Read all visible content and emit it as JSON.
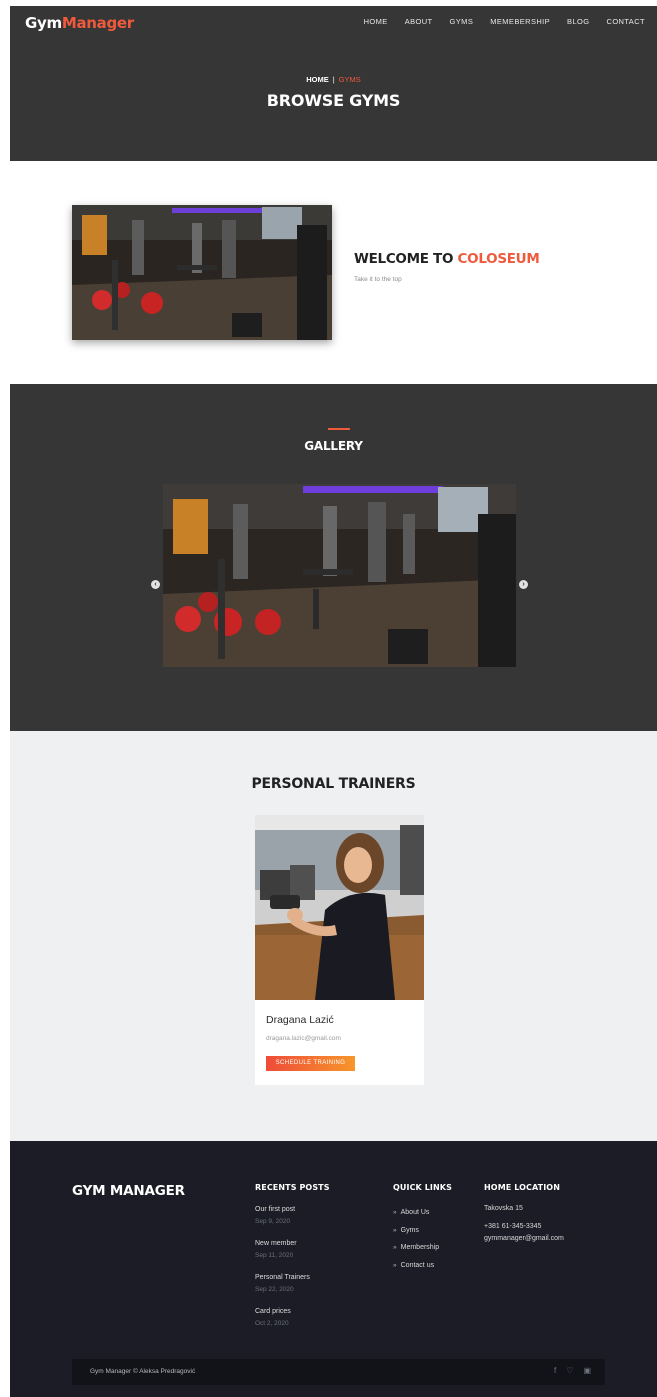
{
  "header": {
    "logo_part1": "Gym",
    "logo_part2": "Manager",
    "nav": [
      "HOME",
      "ABOUT",
      "GYMS",
      "MEMEBERSHIP",
      "BLOG",
      "CONTACT"
    ],
    "breadcrumb_home": "HOME",
    "breadcrumb_separator": "|",
    "breadcrumb_current": "GYMS",
    "title": "BROWSE GYMS"
  },
  "welcome": {
    "title_prefix": "WELCOME TO",
    "title_highlight": "COLOSEUM",
    "subtitle": "Take it to the top"
  },
  "gallery": {
    "title": "GALLERY",
    "prev_icon": "chevron-left-icon",
    "next_icon": "chevron-right-icon"
  },
  "trainers": {
    "title": "PERSONAL TRAINERS",
    "items": [
      {
        "name": "Dragana Lazić",
        "email": "dragana.lazic@gmail.com",
        "button": "SCHEDULE TRAINING"
      }
    ]
  },
  "footer": {
    "brand": "GYM MANAGER",
    "recent_posts_title": "RECENTS POSTS",
    "posts": [
      {
        "title": "Our first post",
        "date": "Sep 9, 2020"
      },
      {
        "title": "New member",
        "date": "Sep 11, 2020"
      },
      {
        "title": "Personal Trainers",
        "date": "Sep 22, 2020"
      },
      {
        "title": "Card prices",
        "date": "Oct 2, 2020"
      }
    ],
    "quick_links_title": "QUICK LINKS",
    "links": [
      "About Us",
      "Gyms",
      "Membership",
      "Contact us"
    ],
    "location_title": "HOME LOCATION",
    "address": "Takovska 15",
    "phone": "+381 61-345-3345",
    "email": "gymmanager@gmail.com",
    "copyright": "Gym Manager © Aleksa Predragović",
    "social_icons": [
      "facebook-icon",
      "twitter-icon",
      "instagram-icon"
    ]
  },
  "colors": {
    "accent": "#ef5a3c",
    "dark_section": "#363636",
    "footer_bg": "#1b1c26",
    "light_section": "#eff0f2"
  }
}
